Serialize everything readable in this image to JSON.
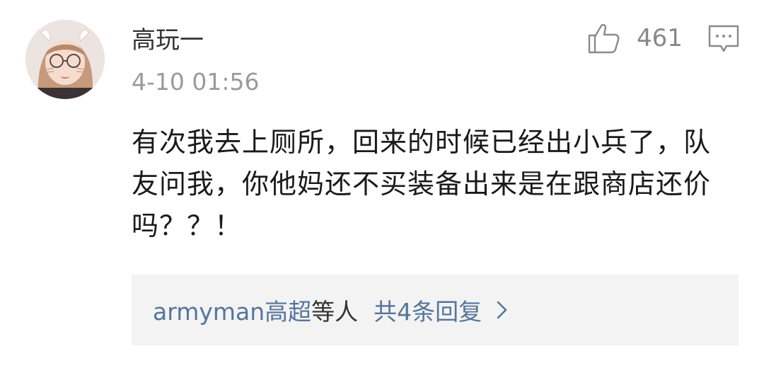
{
  "comment": {
    "username": "高玩一",
    "timestamp": "4-10 01:56",
    "likes": "461",
    "text": "有次我去上厕所，回来的时候已经出小兵了，队友问我，你他妈还不买装备出来是在跟商店还价吗？？！",
    "replies": {
      "users": "armyman高超",
      "others_suffix": "等人",
      "count_label": "共4条回复"
    }
  },
  "icons": {
    "like": "thumbs-up-icon",
    "comment": "comment-bubble-icon",
    "chevron": "chevron-right-icon"
  },
  "colors": {
    "link": "#56759a",
    "muted": "#9a9a9a",
    "reply_bg": "#f3f3f3"
  }
}
